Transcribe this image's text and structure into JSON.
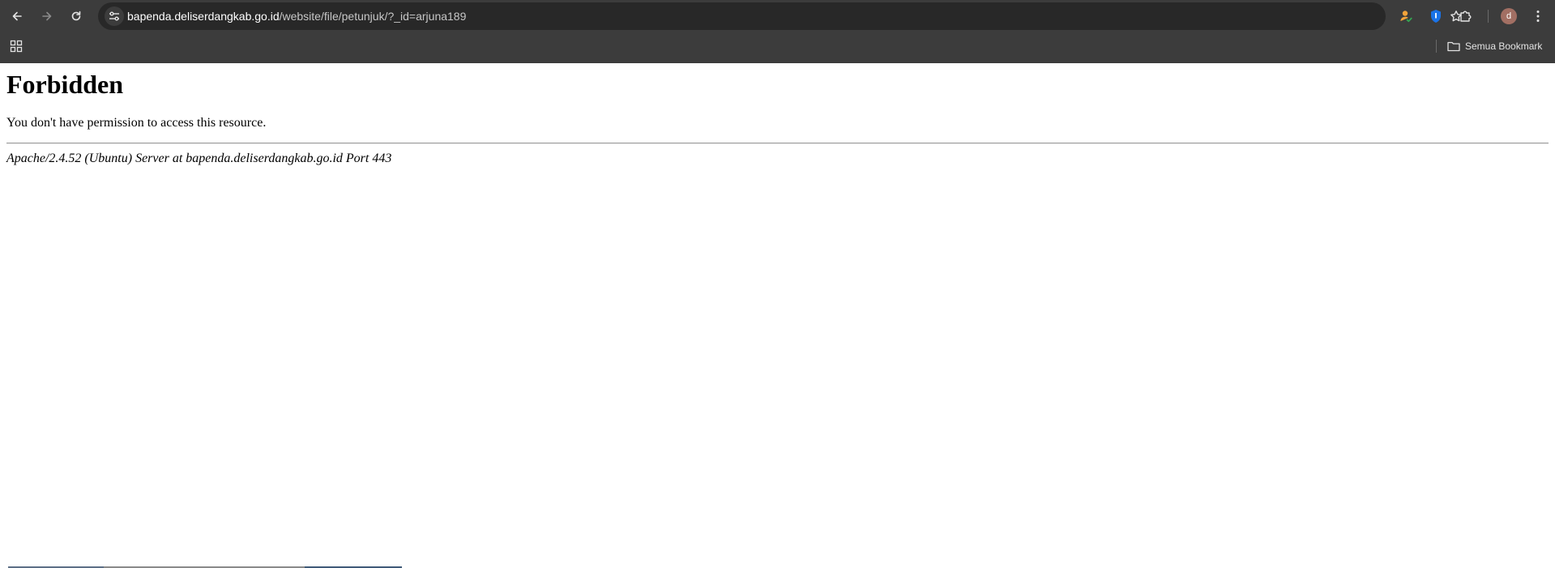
{
  "browser": {
    "url_host": "bapenda.deliserdangkab.go.id",
    "url_path": "/website/file/petunjuk/?_id=arjuna189",
    "profile_initial": "d",
    "all_bookmarks_label": "Semua Bookmark",
    "icons": {
      "back": "back-arrow-icon",
      "forward": "forward-arrow-icon",
      "reload": "reload-icon",
      "site_info": "tune-icon",
      "bookmark_star": "star-icon",
      "extension_1": "person-check-icon",
      "extension_2": "password-manager-shield-icon",
      "extensions": "puzzle-icon",
      "menu": "kebab-menu-icon",
      "apps": "apps-grid-icon",
      "folder": "folder-icon"
    },
    "colors": {
      "chrome_bg": "#3c3c3c",
      "omnibox_bg": "#282828",
      "avatar_bg": "#a26f63",
      "shield_blue": "#1a73e8"
    }
  },
  "page": {
    "heading": "Forbidden",
    "message": "You don't have permission to access this resource.",
    "server_signature": "Apache/2.4.52 (Ubuntu) Server at bapenda.deliserdangkab.go.id Port 443"
  }
}
